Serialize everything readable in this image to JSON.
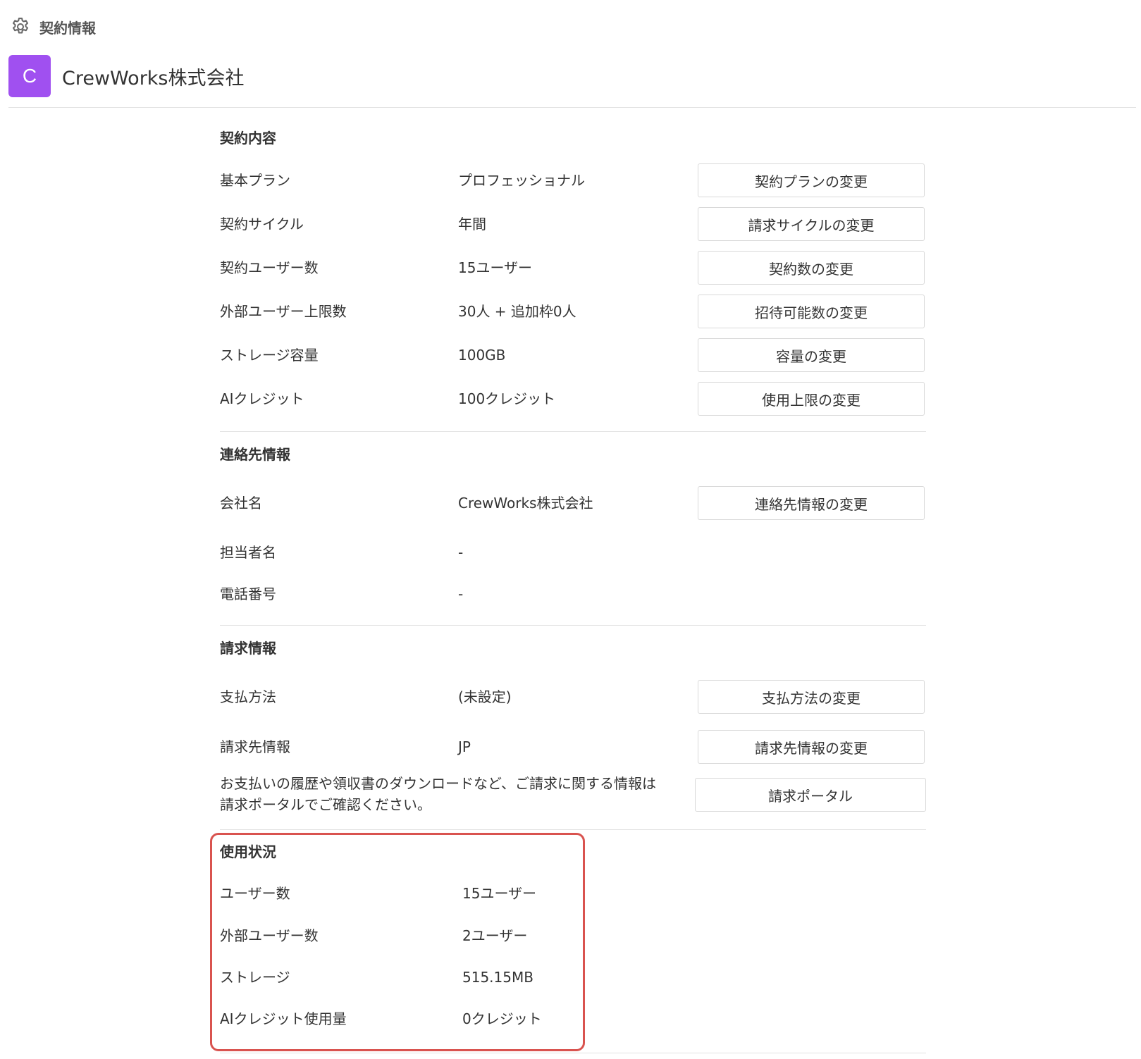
{
  "breadcrumb": {
    "icon": "gear-icon",
    "label": "契約情報"
  },
  "company": {
    "avatar_letter": "C",
    "avatar_color": "#a050f0",
    "name": "CrewWorks株式会社"
  },
  "contract": {
    "title": "契約内容",
    "rows": [
      {
        "label": "基本プラン",
        "value": "プロフェッショナル",
        "action": "契約プランの変更"
      },
      {
        "label": "契約サイクル",
        "value": "年間",
        "action": "請求サイクルの変更"
      },
      {
        "label": "契約ユーザー数",
        "value": "15ユーザー",
        "action": "契約数の変更"
      },
      {
        "label": "外部ユーザー上限数",
        "value": "30人 + 追加枠0人",
        "action": "招待可能数の変更"
      },
      {
        "label": "ストレージ容量",
        "value": "100GB",
        "action": "容量の変更"
      },
      {
        "label": "AIクレジット",
        "value": "100クレジット",
        "action": "使用上限の変更"
      }
    ]
  },
  "contact": {
    "title": "連絡先情報",
    "rows": [
      {
        "label": "会社名",
        "value": "CrewWorks株式会社",
        "action": "連絡先情報の変更"
      },
      {
        "label": "担当者名",
        "value": "-"
      },
      {
        "label": "電話番号",
        "value": "-"
      }
    ]
  },
  "billing": {
    "title": "請求情報",
    "rows": [
      {
        "label": "支払方法",
        "value": "(未設定)",
        "action": "支払方法の変更"
      },
      {
        "label": "請求先情報",
        "value": "JP",
        "action": "請求先情報の変更"
      }
    ],
    "portal_note_line1": "お支払いの履歴や領収書のダウンロードなど、ご請求に関する情報は",
    "portal_note_line2": "請求ポータルでご確認ください。",
    "portal_button": "請求ポータル"
  },
  "usage": {
    "title": "使用状況",
    "highlight_color": "#d9534f",
    "rows": [
      {
        "label": "ユーザー数",
        "value": "15ユーザー"
      },
      {
        "label": "外部ユーザー数",
        "value": "2ユーザー"
      },
      {
        "label": "ストレージ",
        "value": "515.15MB"
      },
      {
        "label": "AIクレジット使用量",
        "value": "0クレジット"
      }
    ]
  }
}
